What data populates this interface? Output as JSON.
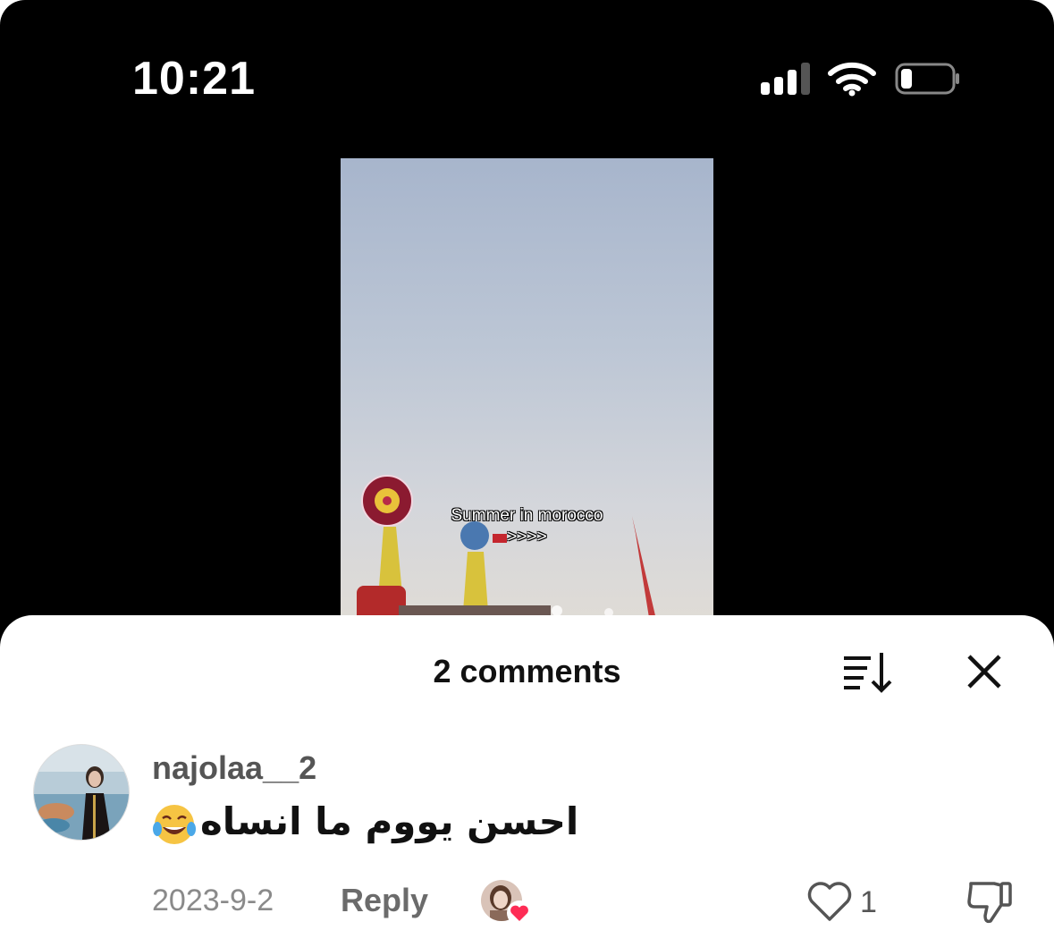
{
  "status_bar": {
    "time": "10:21"
  },
  "video": {
    "overlay_line1": "Summer in morocco",
    "overlay_line2": ">>>>"
  },
  "comments_sheet": {
    "title": "2 comments"
  },
  "comments": [
    {
      "username": "najolaa__2",
      "text": "احسن يووم ما انساه",
      "emoji": "face-with-tears-of-joy",
      "date": "2023-9-2",
      "reply_label": "Reply",
      "like_count": "1",
      "liked_by_creator": true
    }
  ],
  "colors": {
    "like_heart": "#fe2c55",
    "text_secondary": "#8a8a8a"
  }
}
